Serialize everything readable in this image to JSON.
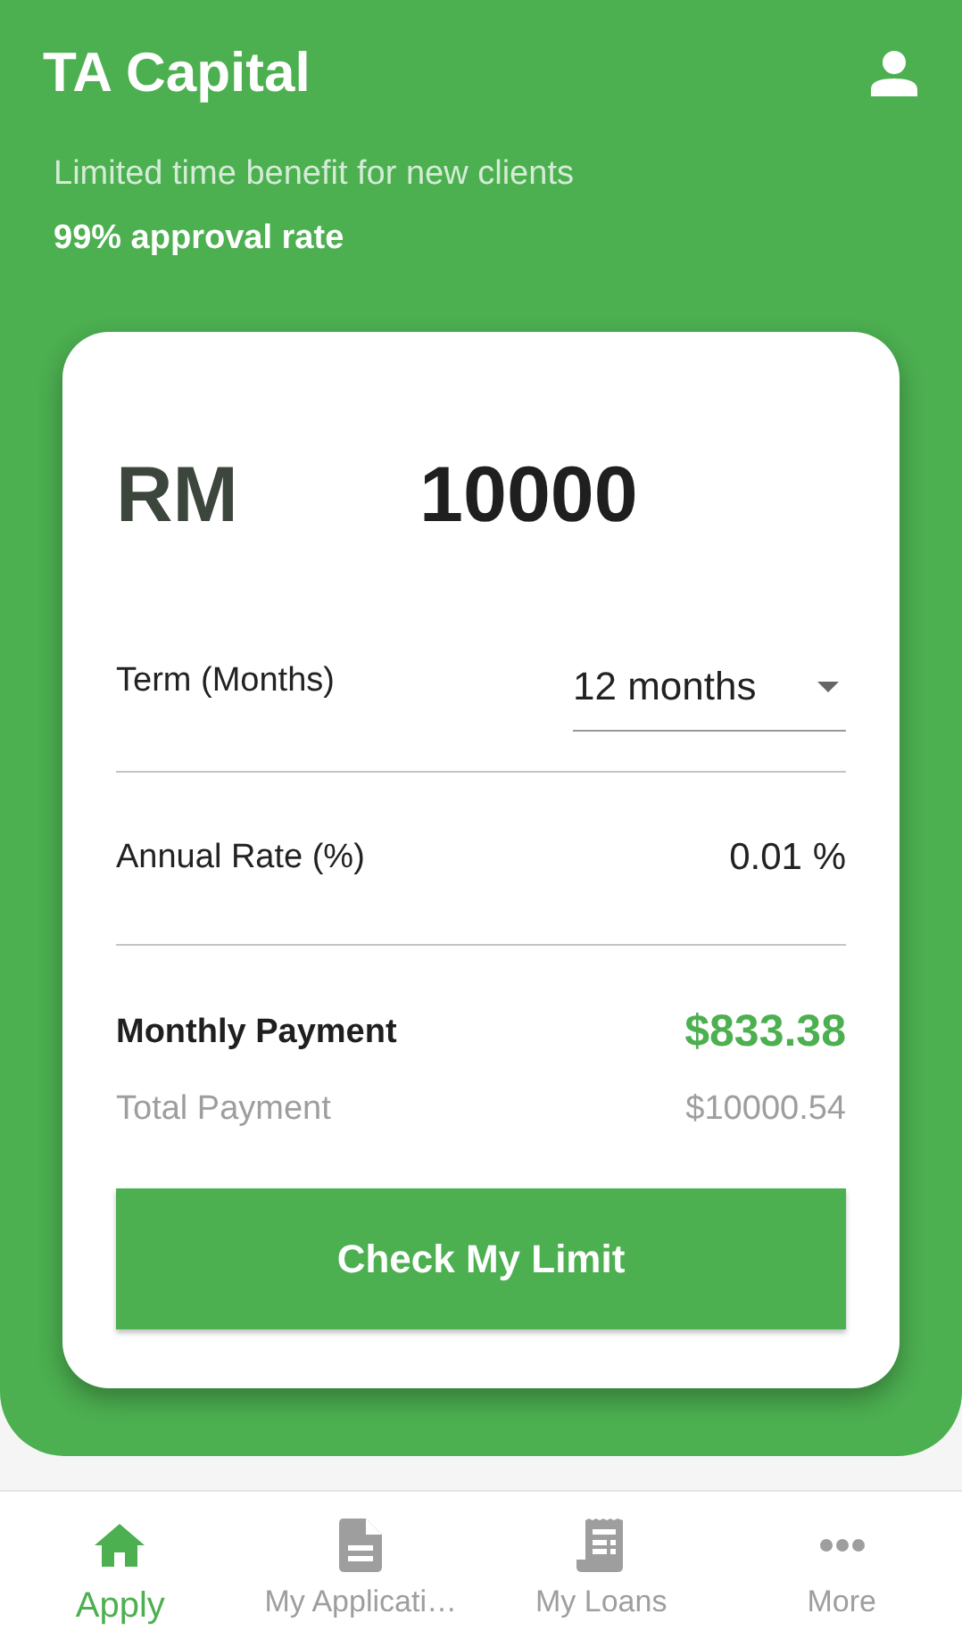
{
  "header": {
    "title": "TA Capital",
    "subtitle": "Limited time benefit for new clients",
    "highlight": "99% approval rate"
  },
  "card": {
    "currency": "RM",
    "amount": "10000",
    "term": {
      "label": "Term (Months)",
      "value": "12 months"
    },
    "rate": {
      "label": "Annual Rate (%)",
      "value": "0.01 %"
    },
    "monthly": {
      "label": "Monthly Payment",
      "value": "$833.38"
    },
    "total": {
      "label": "Total Payment",
      "value": "$10000.54"
    },
    "button": "Check My Limit"
  },
  "nav": [
    {
      "kind": "home",
      "label": "Apply",
      "selected": true
    },
    {
      "kind": "document",
      "label": "My Applicati…",
      "selected": false
    },
    {
      "kind": "receipt",
      "label": "My Loans",
      "selected": false
    },
    {
      "kind": "more",
      "label": "More",
      "selected": false
    }
  ]
}
